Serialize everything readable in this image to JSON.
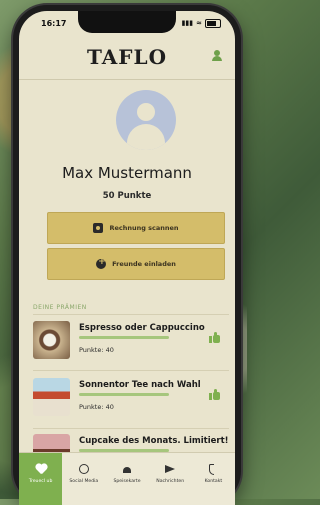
{
  "status": {
    "time": "16:17"
  },
  "header": {
    "logo": "TAFLO"
  },
  "profile": {
    "name": "Max Mustermann",
    "points": "50 Punkte"
  },
  "actions": [
    {
      "label": "Rechnung scannen",
      "icon": "camera-icon"
    },
    {
      "label": "Freunde einladen",
      "icon": "invite-icon"
    }
  ],
  "rewards": {
    "section_title": "DEINE PRÄMIEN",
    "items": [
      {
        "title": "Espresso oder Cappuccino",
        "points": "Punkte: 40",
        "progress": 1.0
      },
      {
        "title": "Sonnentor Tee nach Wahl",
        "points": "Punkte: 40",
        "progress": 1.0
      },
      {
        "title": "Cupcake des Monats. Limitiert!",
        "points": "",
        "progress": 1.0
      }
    ]
  },
  "tabs": [
    {
      "label": "Treuecl ub",
      "icon": "heart-icon",
      "active": true
    },
    {
      "label": "Social Media",
      "icon": "share-icon",
      "active": false
    },
    {
      "label": "Speisekarte",
      "icon": "menu-icon",
      "active": false
    },
    {
      "label": "Nachrichten",
      "icon": "send-icon",
      "active": false
    },
    {
      "label": "Kontakt",
      "icon": "phone-icon",
      "active": false
    }
  ],
  "colors": {
    "accent": "#7fb04f",
    "button": "#d4bd6a",
    "background": "#e9e4cd"
  }
}
